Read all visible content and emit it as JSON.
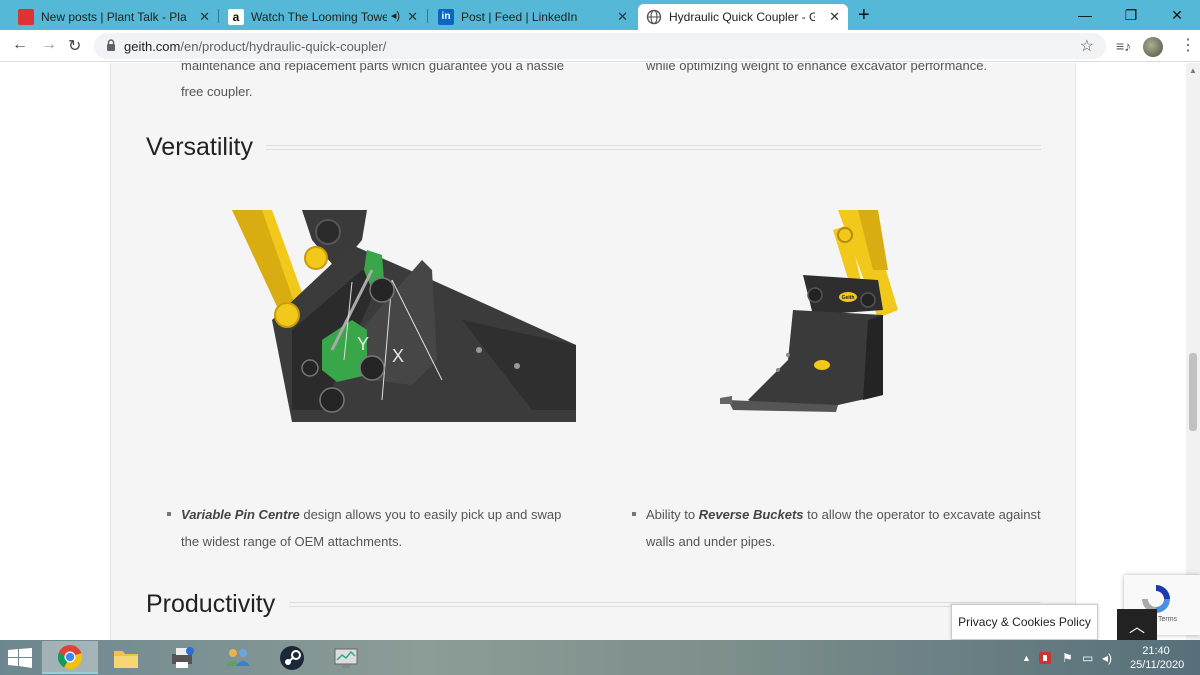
{
  "tabs": [
    {
      "title": "New posts | Plant Talk - Plant Ma",
      "icon": "plant-talk-icon"
    },
    {
      "title": "Watch The Looming Tower S",
      "icon": "amazon-icon"
    },
    {
      "title": "Post | Feed | LinkedIn",
      "icon": "linkedin-icon"
    },
    {
      "title": "Hydraulic Quick Coupler - Geith I",
      "icon": "globe-icon"
    }
  ],
  "address": {
    "domain": "geith.com",
    "path": "/en/product/hydraulic-quick-coupler/"
  },
  "page": {
    "intro_left_line1": "maintenance and replacement parts which guarantee you a hassle",
    "intro_left_line2": "free coupler.",
    "intro_right_line1": "while optimizing weight to enhance excavator performance.",
    "section1_title": "Versatility",
    "diagram_label_y": "Y",
    "diagram_label_x": "X",
    "bullet_left_bold": "Variable Pin Centre",
    "bullet_left_rest": " design allows you to easily pick up and swap",
    "bullet_left_line2": "the widest range of OEM attachments.",
    "bullet_right_pre": "Ability to ",
    "bullet_right_bold": "Reverse Buckets",
    "bullet_right_rest": " to allow the operator to excavate against",
    "bullet_right_line2": "walls and under pipes.",
    "section2_title": "Productivity",
    "brand_mark": "Geith"
  },
  "recaptcha": {
    "terms": "Terms"
  },
  "privacy_label": "Privacy & Cookies Policy",
  "clock": {
    "time": "21:40",
    "date": "25/11/2020"
  },
  "colors": {
    "tabbar": "#54b8d6",
    "coupler_green": "#3aa64a",
    "arm_yellow": "#f2c81a"
  }
}
